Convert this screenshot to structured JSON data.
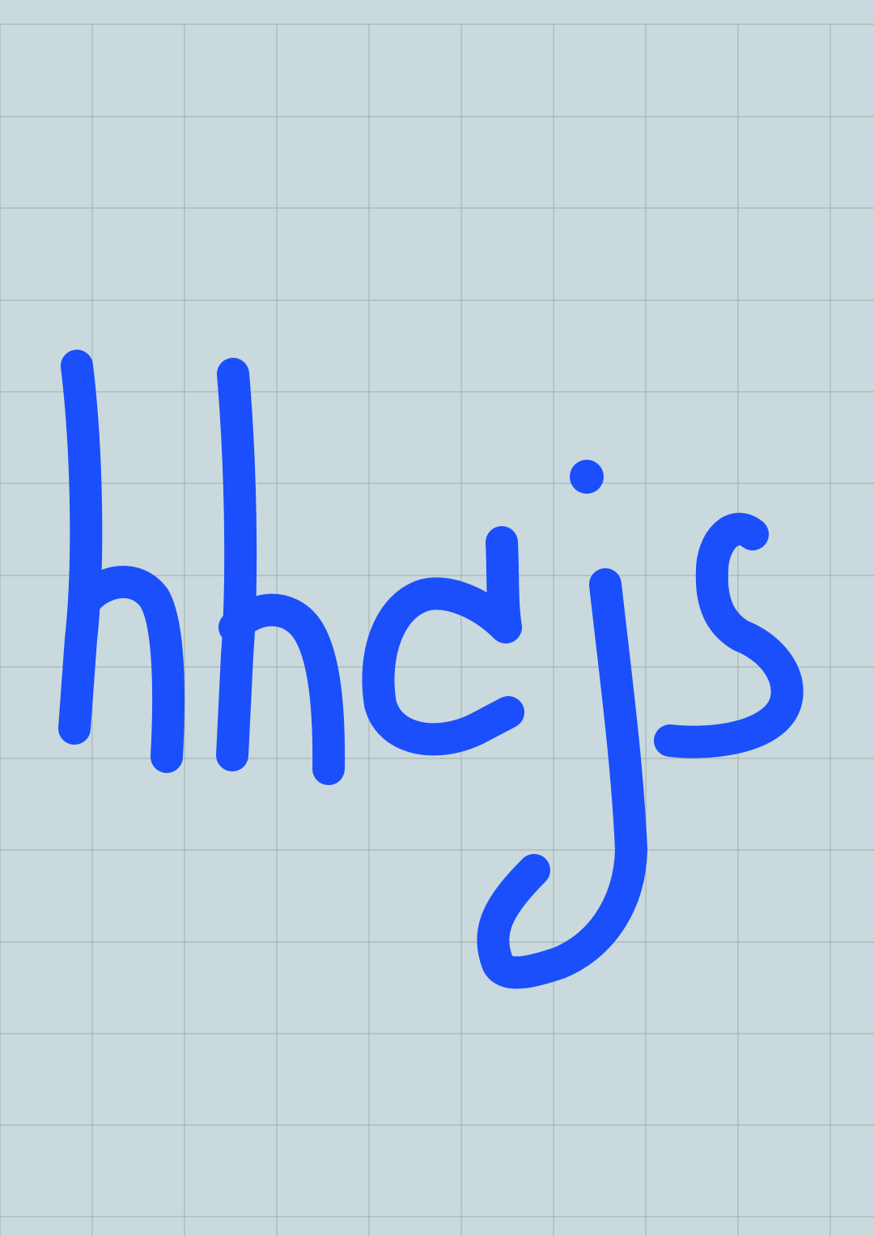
{
  "canvas": {
    "background_color": "#c9d9dd",
    "grid_color": "#9fb0aa",
    "grid": true
  },
  "ink": {
    "color": "#1a4ffb",
    "handwritten_text": "hhcjs"
  }
}
